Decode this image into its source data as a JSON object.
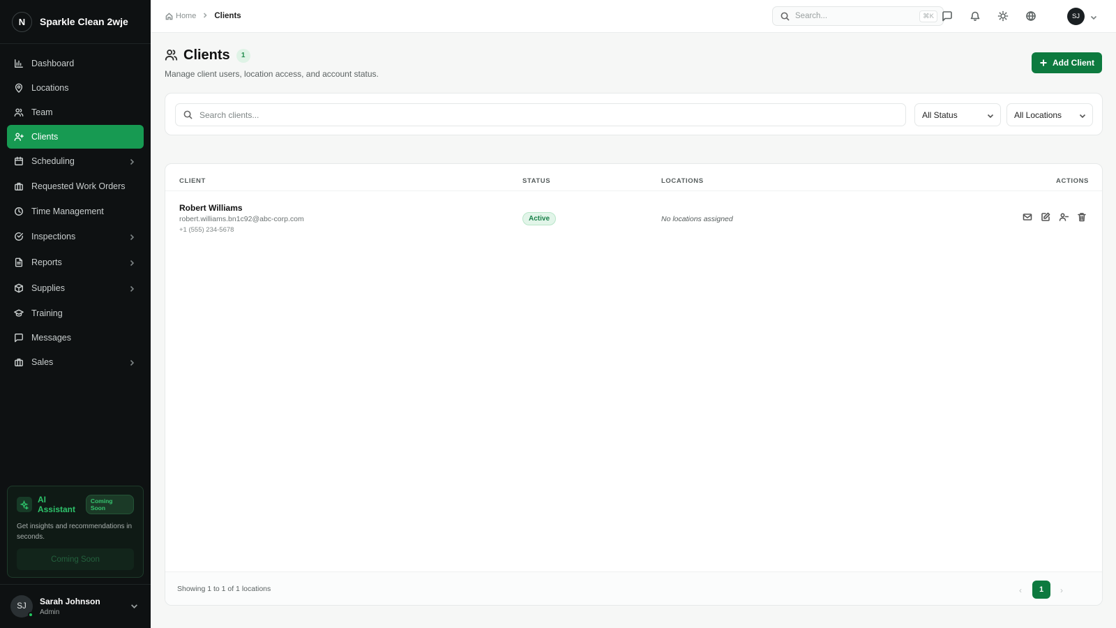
{
  "brand": {
    "logo_letter": "N",
    "name": "Sparkle Clean 2wje"
  },
  "sidebar": {
    "items": [
      {
        "label": "Dashboard",
        "icon": "bar-chart-icon",
        "active": false,
        "has_chevron": false
      },
      {
        "label": "Locations",
        "icon": "map-pin-icon",
        "active": false,
        "has_chevron": false
      },
      {
        "label": "Team",
        "icon": "users-icon",
        "active": false,
        "has_chevron": false
      },
      {
        "label": "Clients",
        "icon": "user-plus-icon",
        "active": true,
        "has_chevron": false
      },
      {
        "label": "Scheduling",
        "icon": "calendar-icon",
        "active": false,
        "has_chevron": true
      },
      {
        "label": "Requested Work Orders",
        "icon": "briefcase-icon",
        "active": false,
        "has_chevron": false
      },
      {
        "label": "Time Management",
        "icon": "clock-icon",
        "active": false,
        "has_chevron": false
      },
      {
        "label": "Inspections",
        "icon": "check-circle-icon",
        "active": false,
        "has_chevron": true
      },
      {
        "label": "Reports",
        "icon": "file-text-icon",
        "active": false,
        "has_chevron": true
      },
      {
        "label": "Supplies",
        "icon": "package-icon",
        "active": false,
        "has_chevron": true
      },
      {
        "label": "Training",
        "icon": "graduation-cap-icon",
        "active": false,
        "has_chevron": false
      },
      {
        "label": "Messages",
        "icon": "message-square-icon",
        "active": false,
        "has_chevron": false
      },
      {
        "label": "Sales",
        "icon": "briefcase-icon",
        "active": false,
        "has_chevron": true
      }
    ],
    "ai_card": {
      "title": "AI Assistant",
      "badge": "Coming Soon",
      "description": "Get insights and recommendations in seconds.",
      "button": "Coming Soon"
    },
    "user": {
      "initials": "SJ",
      "name": "Sarah Johnson",
      "role": "Admin"
    }
  },
  "header": {
    "breadcrumb": {
      "home": "Home",
      "current": "Clients"
    },
    "search_placeholder": "Search...",
    "search_shortcut": "⌘K",
    "avatar_initials": "SJ"
  },
  "page": {
    "title": "Clients",
    "count": "1",
    "subtitle": "Manage client users, location access, and account status.",
    "add_button": "Add Client"
  },
  "filters": {
    "search_placeholder": "Search clients...",
    "status": "All Status",
    "locations": "All Locations"
  },
  "table": {
    "headers": {
      "client": "CLIENT",
      "status": "STATUS",
      "locations": "LOCATIONS",
      "actions": "ACTIONS"
    },
    "rows": [
      {
        "name": "Robert Williams",
        "email": "robert.williams.bn1c92@abc-corp.com",
        "phone": "+1 (555) 234-5678",
        "status": "Active",
        "locations": "No locations assigned"
      }
    ],
    "footer": {
      "showing": "Showing 1 to 1 of 1 locations",
      "page": "1"
    }
  },
  "colors": {
    "accent": "#0d7a3f",
    "active_nav": "#179a52",
    "sidebar_bg": "#0e1112"
  }
}
